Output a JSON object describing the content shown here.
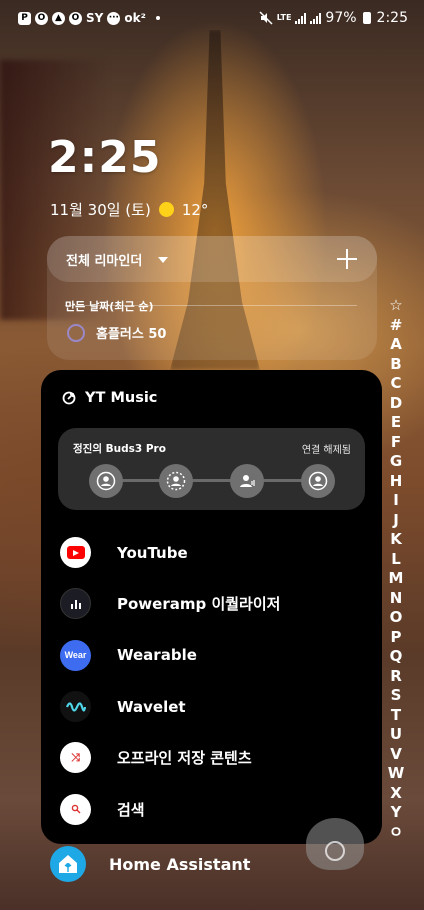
{
  "status_bar": {
    "left_icons": [
      "P",
      "O",
      "▲",
      "O"
    ],
    "carrier_text": "SY",
    "chat_icon": "talk",
    "ok_text": "ok²",
    "lte": "LTE",
    "battery": "97%",
    "time": "2:25"
  },
  "clock": {
    "time": "2:25",
    "date": "11월 30일 (토)",
    "temperature": "12°"
  },
  "reminder": {
    "title": "전체 리마인더",
    "section": "만든 날짜(최근 순)",
    "items": [
      {
        "label": "홈플러스 50"
      }
    ]
  },
  "index": [
    "A",
    "B",
    "C",
    "D",
    "E",
    "F",
    "G",
    "H",
    "I",
    "J",
    "K",
    "L",
    "M",
    "N",
    "O",
    "P",
    "Q",
    "R",
    "S",
    "T",
    "U",
    "V",
    "W",
    "X",
    "Y"
  ],
  "index_extra": {
    "star": "☆",
    "hash": "#",
    "end": "ㅇ"
  },
  "popup": {
    "title": "YT Music",
    "device": {
      "name": "정진의 Buds3 Pro",
      "action": "연결 해제됨"
    },
    "apps": [
      {
        "label": "YouTube",
        "icon": "youtube-icon"
      },
      {
        "label": "Poweramp 이퀄라이저",
        "icon": "poweramp-icon"
      },
      {
        "label": "Wearable",
        "icon": "wear-icon"
      },
      {
        "label": "Wavelet",
        "icon": "wavelet-icon"
      },
      {
        "label": "오프라인 저장 콘텐츠",
        "icon": "shuffle-icon"
      },
      {
        "label": "검색",
        "icon": "search-icon"
      }
    ],
    "wear_badge": "Wear"
  },
  "home_assistant": {
    "label": "Home Assistant"
  },
  "colors": {
    "accent_blue": "#3d6cf0",
    "youtube_red": "#ff0000",
    "ha_blue": "#1fa8e6",
    "sun": "#ffd21a"
  }
}
